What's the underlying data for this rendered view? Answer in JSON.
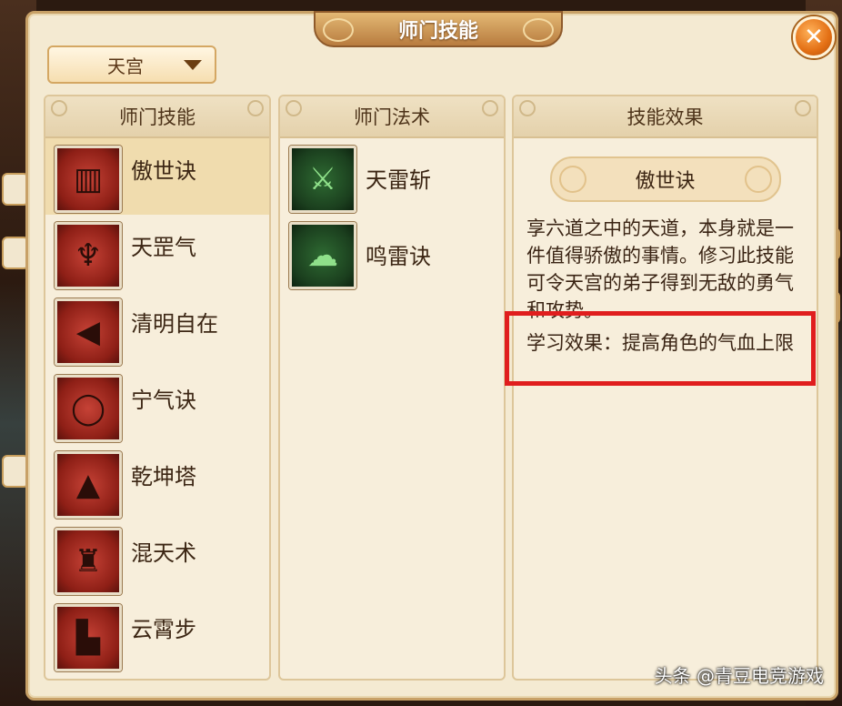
{
  "window": {
    "title": "师门技能",
    "close_symbol": "✕"
  },
  "school_select": {
    "value": "天宫"
  },
  "skills_panel": {
    "header": "师门技能",
    "items": [
      {
        "name": "傲世诀",
        "icon": "scroll-icon",
        "selected": true,
        "glyph": "▥"
      },
      {
        "name": "天罡气",
        "icon": "warrior-icon",
        "selected": false,
        "glyph": "♆"
      },
      {
        "name": "清明自在",
        "icon": "horn-icon",
        "selected": false,
        "glyph": "◀"
      },
      {
        "name": "宁气诀",
        "icon": "orb-icon",
        "selected": false,
        "glyph": "◯"
      },
      {
        "name": "乾坤塔",
        "icon": "pagoda-icon",
        "selected": false,
        "glyph": "▲"
      },
      {
        "name": "混天术",
        "icon": "vase-icon",
        "selected": false,
        "glyph": "♜"
      },
      {
        "name": "云霄步",
        "icon": "boot-icon",
        "selected": false,
        "glyph": "▙"
      }
    ]
  },
  "spells_panel": {
    "header": "师门法术",
    "items": [
      {
        "name": "天雷斩",
        "icon": "thunder-blade-icon",
        "glyph": "⚔"
      },
      {
        "name": "鸣雷诀",
        "icon": "cloud-lightning-icon",
        "glyph": "☁"
      }
    ]
  },
  "effect_panel": {
    "header": "技能效果",
    "skill_name": "傲世诀",
    "description": "享六道之中的天道，本身就是一件值得骄傲的事情。修习此技能可令天宫的弟子得到无敌的勇气和攻势。",
    "learn_effect": "学习效果：提高角色的气血上限"
  },
  "watermark": "头条 @青豆电竞游戏",
  "colors": {
    "highlight": "#e01e1e",
    "close": "#e36f14"
  }
}
